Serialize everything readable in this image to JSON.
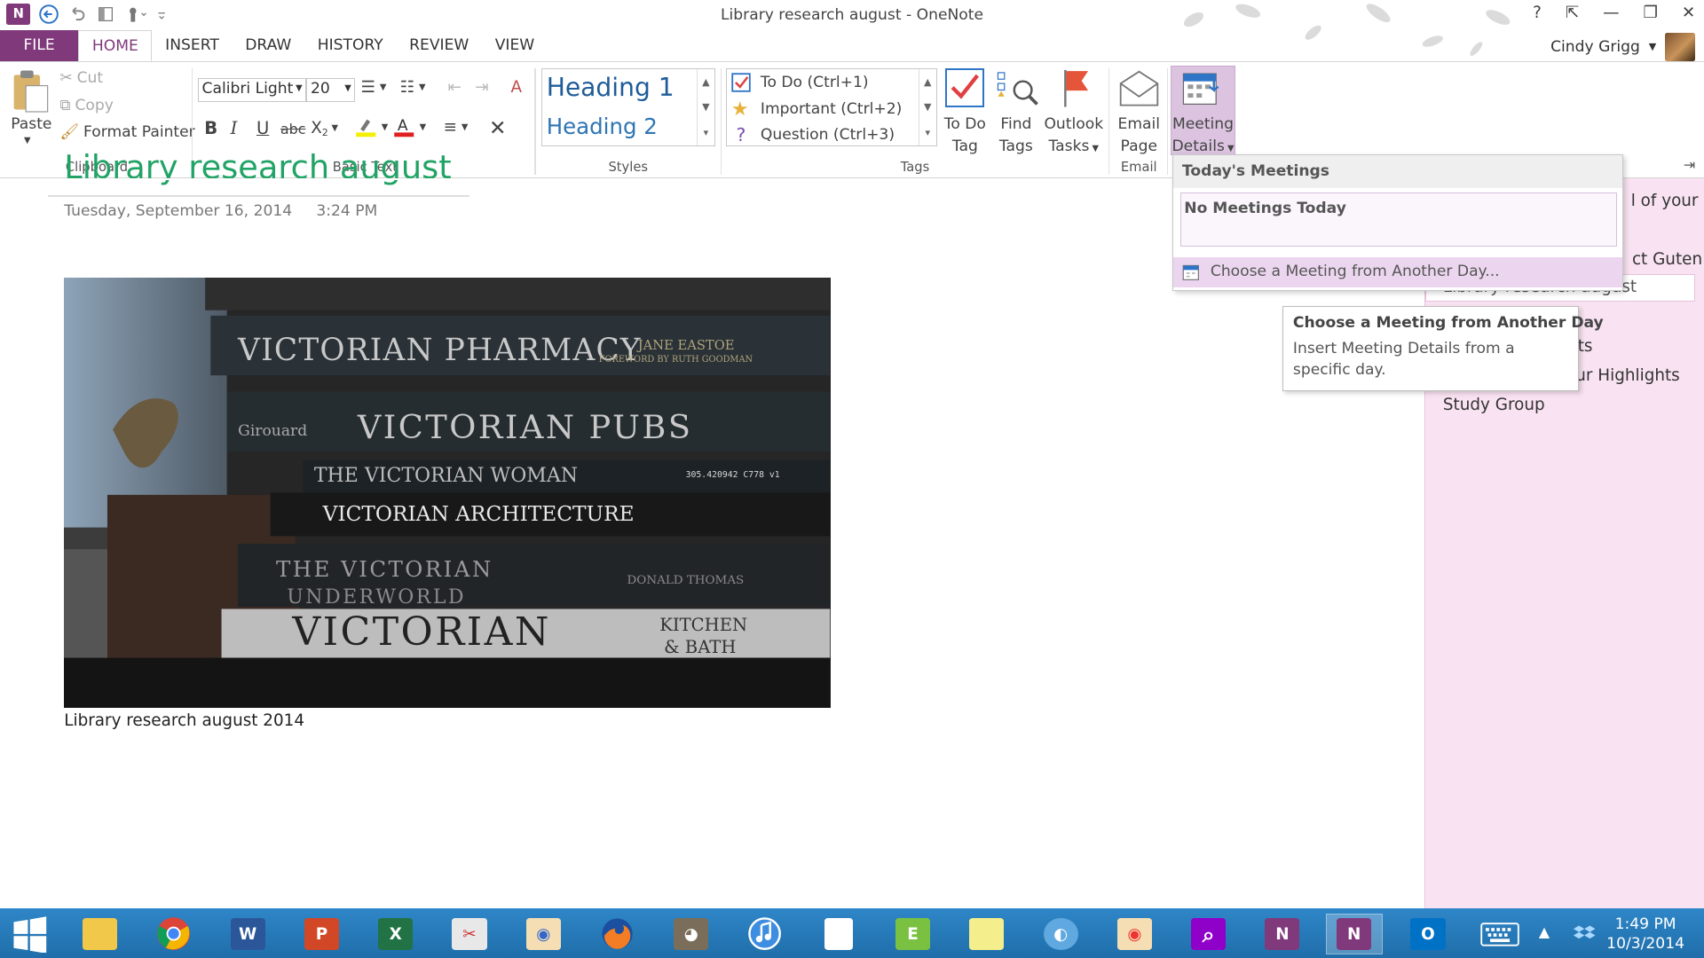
{
  "window": {
    "title": "Library research august - OneNote"
  },
  "tabs": [
    {
      "label": "FILE"
    },
    {
      "label": "HOME"
    },
    {
      "label": "INSERT"
    },
    {
      "label": "DRAW"
    },
    {
      "label": "HISTORY"
    },
    {
      "label": "REVIEW"
    },
    {
      "label": "VIEW"
    }
  ],
  "user": {
    "name": "Cindy Grigg"
  },
  "clipboard": {
    "paste": "Paste",
    "cut": "Cut",
    "copy": "Copy",
    "format_painter": "Format Painter",
    "group": "Clipboard"
  },
  "basic_text": {
    "font": "Calibri Light",
    "size": "20",
    "group": "Basic Text",
    "bold": "B",
    "italic": "I",
    "underline": "U",
    "strike": "abc",
    "subscript": "X",
    "subscript_mark": "2"
  },
  "styles": {
    "h1": "Heading 1",
    "h2": "Heading 2",
    "group": "Styles"
  },
  "tags": {
    "todo": "To Do (Ctrl+1)",
    "important": "Important (Ctrl+2)",
    "question": "Question (Ctrl+3)",
    "group": "Tags",
    "todo_tag": [
      "To Do",
      "Tag"
    ],
    "find_tags": [
      "Find",
      "Tags"
    ],
    "outlook_tasks": [
      "Outlook",
      "Tasks"
    ]
  },
  "email": {
    "label": [
      "Email",
      "Page"
    ],
    "group": "Email"
  },
  "meeting": {
    "label": [
      "Meeting",
      "Details"
    ]
  },
  "page": {
    "title": "Library research august",
    "date": "Tuesday, September 16, 2014",
    "time": "3:24 PM",
    "caption": "Library research august 2014",
    "book_spines": [
      "VICTORIAN PHARMACY",
      "VICTORIAN PUBS",
      "THE VICTORIAN WOMAN",
      "VICTORIAN ARCHITECTURE",
      "THE VICTORIAN",
      "UNDERWORLD",
      "VICTORIAN",
      "KITCHEN",
      "& BATH",
      "Girouard",
      "JANE EASTOE",
      "FOREWORD BY RUTH GOODMAN",
      "DONALD THOMAS",
      "305.420942 C778 v1"
    ]
  },
  "dropdown": {
    "header": "Today's Meetings",
    "empty": "No Meetings Today",
    "choose": "Choose a Meeting from Another Day..."
  },
  "tooltip": {
    "title": "Choose a Meeting from Another Day",
    "body": "Insert Meeting Details from a specific day."
  },
  "side_pages": [
    {
      "label": "l of your"
    },
    {
      "label": "ct Guten"
    },
    {
      "label": "Library research august"
    },
    {
      "label": "ts"
    },
    {
      "label": "ur Highlights"
    },
    {
      "label": "Study Group"
    }
  ],
  "clock": {
    "time": "1:49 PM",
    "date": "10/3/2014"
  },
  "colors": {
    "accent": "#80397b",
    "title_green": "#21a366",
    "taskbar": "#2677b8",
    "side_panel": "#f9e3f2"
  }
}
